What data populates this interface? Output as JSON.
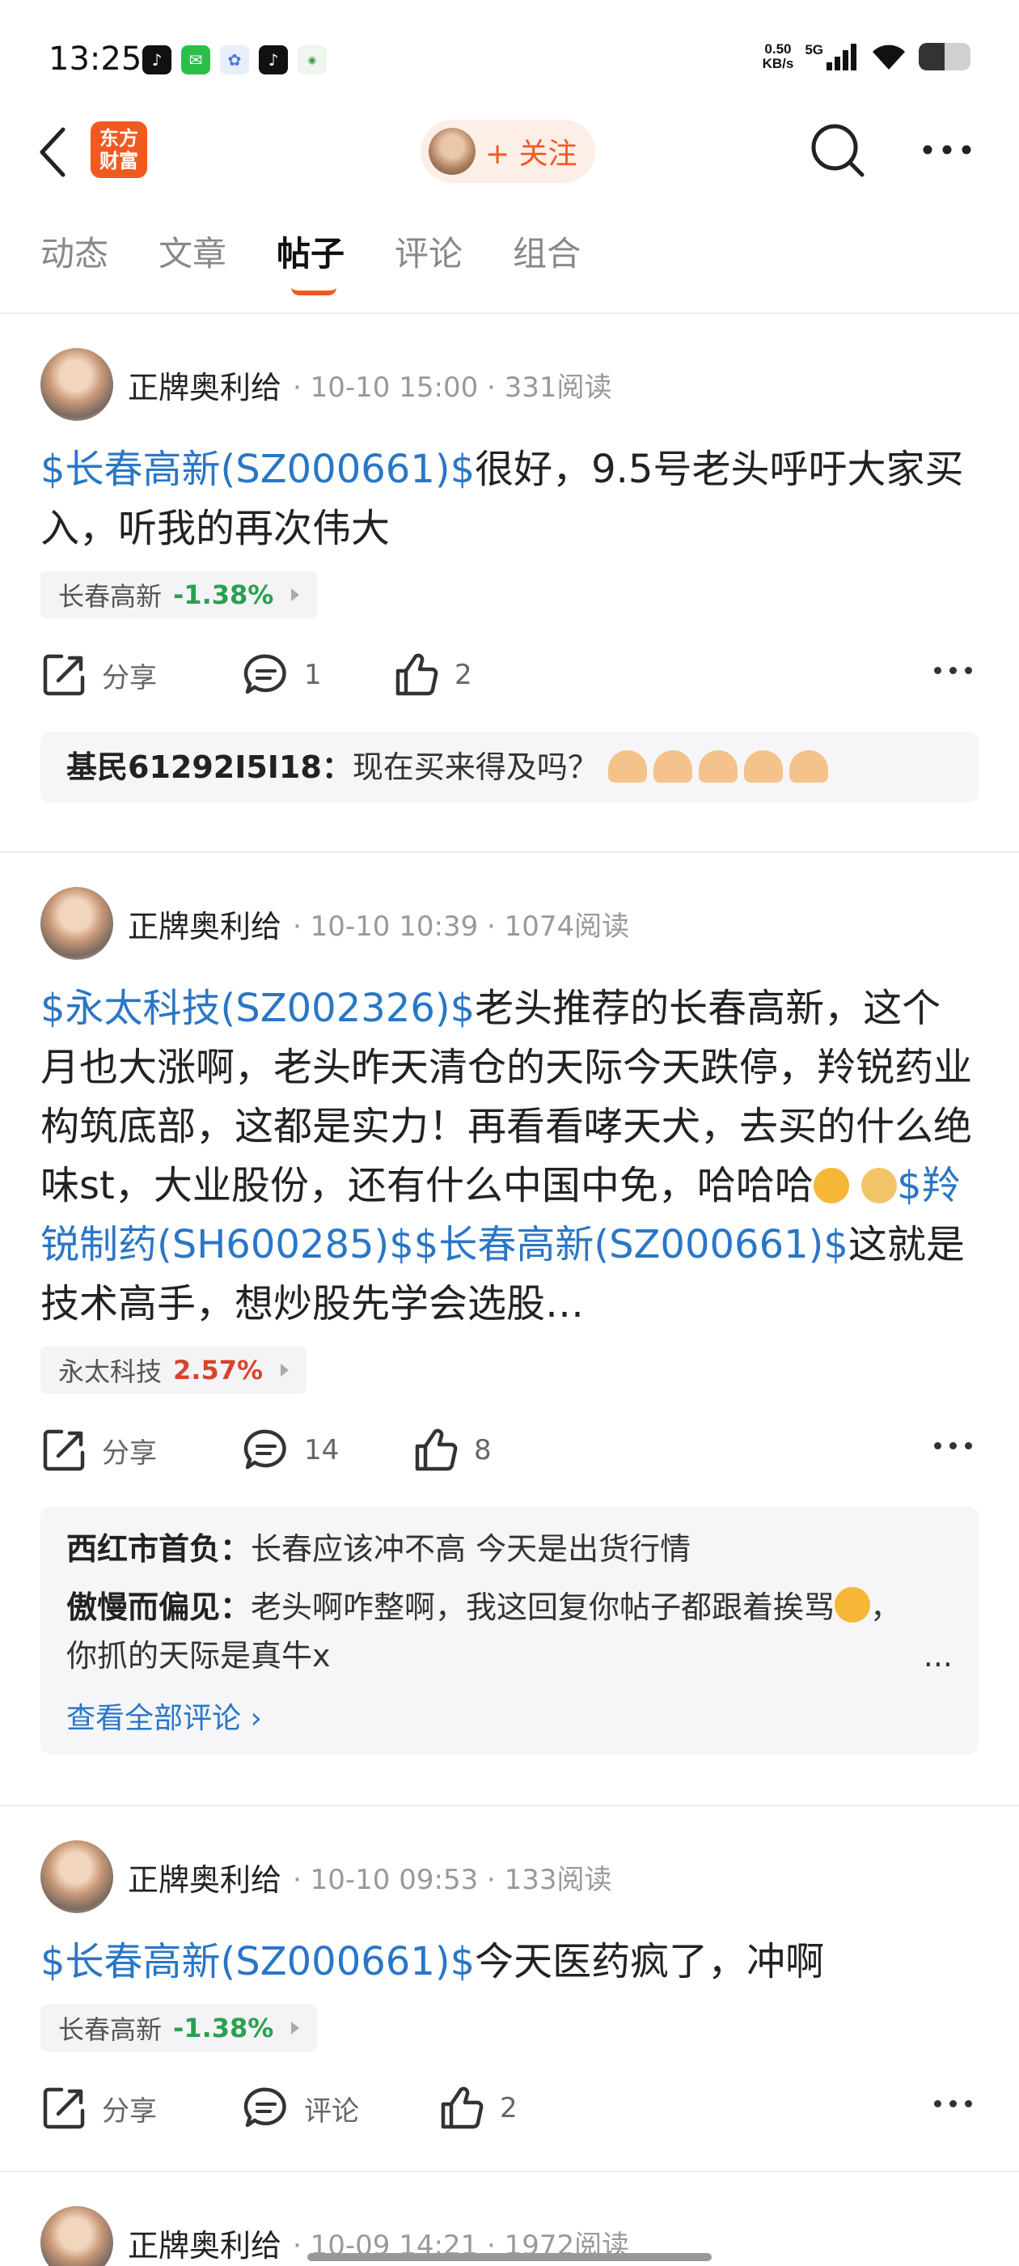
{
  "status_bar": {
    "time": "13:25",
    "net_speed": "0.50",
    "net_unit": "KB/s",
    "network": "5G",
    "battery_level": 0.5
  },
  "nav": {
    "logo_line1": "东方",
    "logo_line2": "财富",
    "follow_label": "+ 关注"
  },
  "tabs": [
    {
      "label": "动态"
    },
    {
      "label": "文章"
    },
    {
      "label": "帖子"
    },
    {
      "label": "评论"
    },
    {
      "label": "组合"
    }
  ],
  "posts": [
    {
      "author": "正牌奥利给",
      "meta": "· 10-10 15:00 · 331阅读",
      "stock_link": "$长春高新(SZ000661)$",
      "text": "很好，9.5号老头呼吁大家买入，听我的再次伟大",
      "tag_name": "长春高新",
      "tag_change": "-1.38%",
      "tag_color": "#2aa050",
      "share": "分享",
      "comments": "1",
      "likes": "2",
      "comment_list": [
        {
          "user": "基民61292I5I18：",
          "text": "现在买来得及吗？"
        }
      ]
    },
    {
      "author": "正牌奥利给",
      "meta": "· 10-10 10:39 · 1074阅读",
      "stock_link": "$永太科技(SZ002326)$",
      "text": "老头推荐的长春高新，这个月也大涨啊，老头昨天清仓的天际今天跌停，羚锐药业构筑底部，这都是实力！再看看哮天犬，去买的什么绝味st，大业股份，还有什么中国中免，哈哈哈",
      "stock_link2": "$羚锐制药(SH600285)$",
      "stock_link3": "$长春高新(SZ000661)$",
      "text_tail": "这就是技术高手，想炒股先学会选股…",
      "tag_name": "永太科技",
      "tag_change": "2.57%",
      "tag_color": "#d9432a",
      "share": "分享",
      "comments": "14",
      "likes": "8",
      "comment_list": [
        {
          "user": "西红市首负：",
          "text": "长春应该冲不高 今天是出货行情"
        },
        {
          "user": "傲慢而偏见：",
          "text": "老头啊咋整啊，我这回复你帖子都跟着挨骂",
          "text2": "，你抓的天际是真牛x",
          "more": "..."
        }
      ],
      "view_all": "查看全部评论 ›"
    },
    {
      "author": "正牌奥利给",
      "meta": "· 10-10 09:53 · 133阅读",
      "stock_link": "$长春高新(SZ000661)$",
      "text": "今天医药疯了，冲啊",
      "tag_name": "长春高新",
      "tag_change": "-1.38%",
      "tag_color": "#2aa050",
      "share": "分享",
      "comments": "评论",
      "likes": "2"
    },
    {
      "author": "正牌奥利给",
      "meta": "· 10-09 14:21 · 1972阅读"
    }
  ]
}
